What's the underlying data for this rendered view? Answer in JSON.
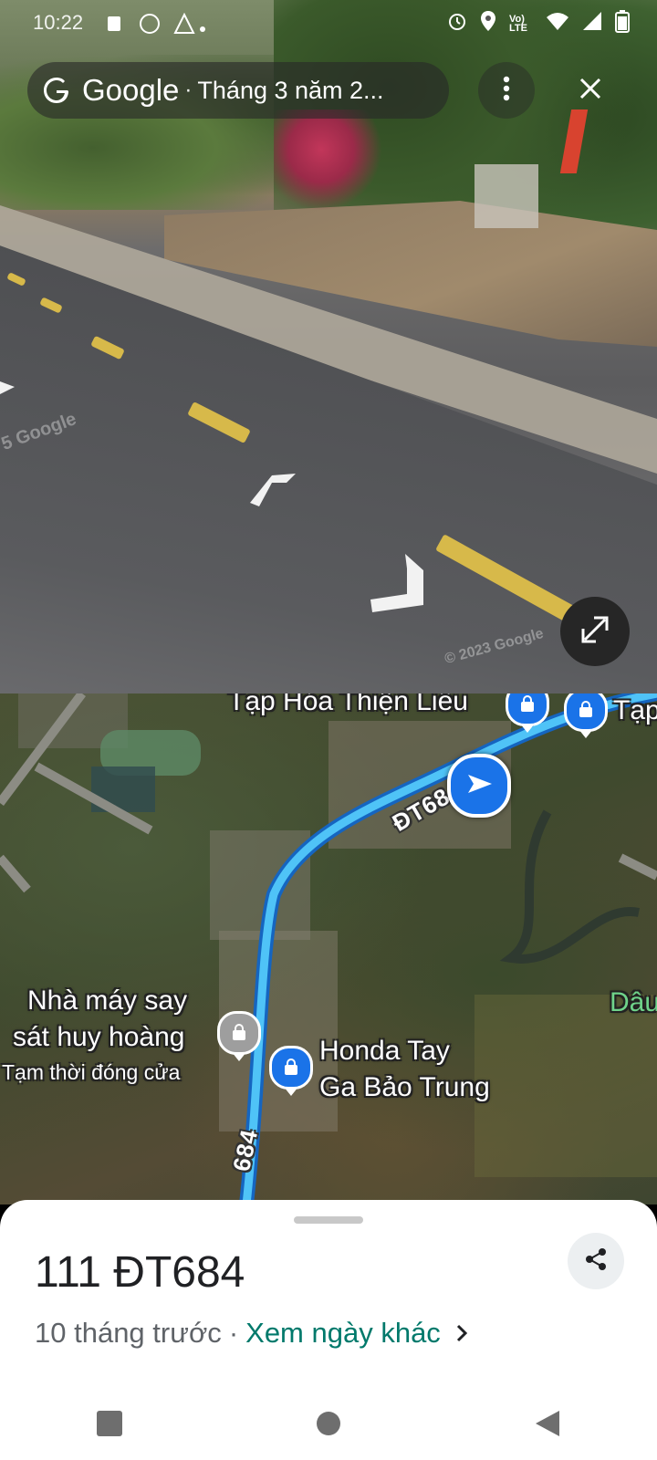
{
  "status_bar": {
    "time": "10:22",
    "icons": [
      "alarm-icon",
      "location-icon",
      "volte-icon",
      "wifi-icon",
      "signal-icon",
      "battery-icon"
    ],
    "volte_text": "Vo) LTE"
  },
  "street_view": {
    "brand": "Google",
    "separator": "·",
    "capture_date": "Tháng 3 năm 2...",
    "watermark_left": "5 Google",
    "watermark_right": "© 2023 Google",
    "more_icon": "more-vert-icon",
    "close_icon": "close-icon",
    "expand_icon": "expand-icon"
  },
  "map": {
    "labels": {
      "shop1": "Tạp Hóa Thiện Liễu",
      "shop2": "Tạp",
      "mill_line1": "Nhà máy say",
      "mill_line2": "sát huy hoàng",
      "mill_status": "Tạm thời đóng cửa",
      "honda_line1": "Honda Tay",
      "honda_line2": "Ga Bảo Trung",
      "right_edge": "Dâu",
      "road_top": "ĐT68",
      "road_bottom": "684"
    }
  },
  "sheet": {
    "title": "111 ĐT684",
    "age": "10 tháng trước",
    "separator": "·",
    "other_dates_link": "Xem ngày khác"
  },
  "colors": {
    "accent_teal": "#00796b",
    "route_blue": "#1a73e8",
    "route_light": "#4fc3f7"
  }
}
